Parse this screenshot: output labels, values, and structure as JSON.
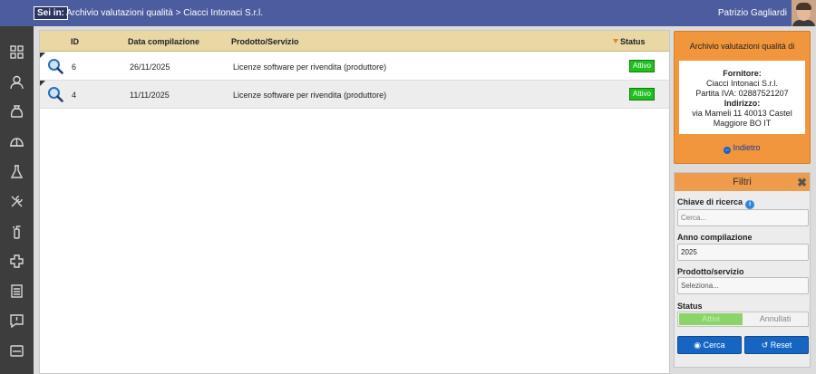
{
  "header": {
    "breadcrumb_tag": "Sei in:",
    "breadcrumb_path": "Archivio valutazioni qualità > Ciacci Intonaci S.r.l.",
    "user_name": "Patrizio Gagliardi"
  },
  "sidebar": {
    "icons": [
      "dashboard-icon",
      "user-icon",
      "bag-icon",
      "helmet-icon",
      "flask-icon",
      "tools-icon",
      "extinguisher-icon",
      "medical-cross-icon",
      "document-icon",
      "alert-message-icon",
      "dvd-icon"
    ]
  },
  "table": {
    "headers": {
      "id": "ID",
      "date": "Data compilazione",
      "product": "Prodotto/Servizio",
      "status": "Status"
    },
    "rows": [
      {
        "id": "6",
        "date": "26/11/2025",
        "product": "Licenze software per rivendita (produttore)",
        "status": "Attivo"
      },
      {
        "id": "4",
        "date": "11/11/2025",
        "product": "Licenze software per rivendita (produttore)",
        "status": "Attivo"
      }
    ]
  },
  "supplier_panel": {
    "title": "Archivio valutazioni qualità di",
    "supplier_label": "Fornitore:",
    "supplier_name": "Ciacci Intonaci S.r.l.",
    "vat": "Partita IVA: 02887521207",
    "address_label": "Indirizzo:",
    "address_line1": "via Mameli 11 40013 Castel",
    "address_line2": "Maggiore BO IT",
    "back_label": "Indietro"
  },
  "filters": {
    "title": "Filtri",
    "search_label": "Chiave di ricerca",
    "search_placeholder": "Cerca...",
    "year_label": "Anno compilazione",
    "year_value": "2025",
    "product_label": "Prodotto/servizio",
    "product_placeholder": "Seleziona...",
    "status_label": "Status",
    "status_on": "Attivi",
    "status_off": "Annullati",
    "search_button": "Cerca",
    "reset_button": "Reset"
  },
  "colors": {
    "topbar": "#4b5d9e",
    "sidebar": "#3d3d3d",
    "table_header": "#e9d7a4",
    "orange_panel": "#f2963d",
    "active_badge": "#1fbf1f",
    "button": "#1765c2"
  }
}
